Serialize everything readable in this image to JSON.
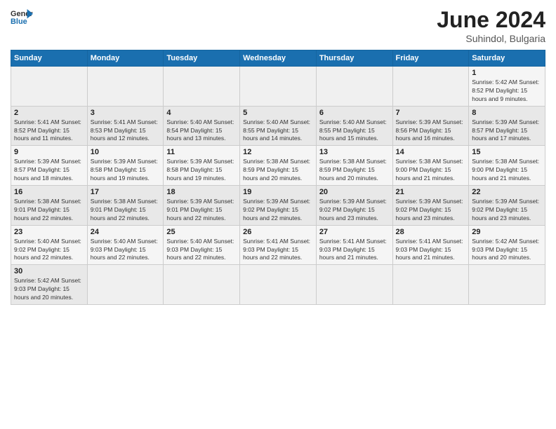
{
  "logo": {
    "general": "General",
    "blue": "Blue"
  },
  "title": {
    "month_year": "June 2024",
    "location": "Suhindol, Bulgaria"
  },
  "weekdays": [
    "Sunday",
    "Monday",
    "Tuesday",
    "Wednesday",
    "Thursday",
    "Friday",
    "Saturday"
  ],
  "weeks": [
    [
      {
        "day": "",
        "info": ""
      },
      {
        "day": "",
        "info": ""
      },
      {
        "day": "",
        "info": ""
      },
      {
        "day": "",
        "info": ""
      },
      {
        "day": "",
        "info": ""
      },
      {
        "day": "",
        "info": ""
      },
      {
        "day": "1",
        "info": "Sunrise: 5:42 AM\nSunset: 8:52 PM\nDaylight: 15 hours and 9 minutes."
      }
    ],
    [
      {
        "day": "2",
        "info": "Sunrise: 5:41 AM\nSunset: 8:52 PM\nDaylight: 15 hours and 11 minutes."
      },
      {
        "day": "3",
        "info": "Sunrise: 5:41 AM\nSunset: 8:53 PM\nDaylight: 15 hours and 12 minutes."
      },
      {
        "day": "4",
        "info": "Sunrise: 5:40 AM\nSunset: 8:54 PM\nDaylight: 15 hours and 13 minutes."
      },
      {
        "day": "5",
        "info": "Sunrise: 5:40 AM\nSunset: 8:55 PM\nDaylight: 15 hours and 14 minutes."
      },
      {
        "day": "6",
        "info": "Sunrise: 5:40 AM\nSunset: 8:55 PM\nDaylight: 15 hours and 15 minutes."
      },
      {
        "day": "7",
        "info": "Sunrise: 5:39 AM\nSunset: 8:56 PM\nDaylight: 15 hours and 16 minutes."
      },
      {
        "day": "8",
        "info": "Sunrise: 5:39 AM\nSunset: 8:57 PM\nDaylight: 15 hours and 17 minutes."
      }
    ],
    [
      {
        "day": "9",
        "info": "Sunrise: 5:39 AM\nSunset: 8:57 PM\nDaylight: 15 hours and 18 minutes."
      },
      {
        "day": "10",
        "info": "Sunrise: 5:39 AM\nSunset: 8:58 PM\nDaylight: 15 hours and 19 minutes."
      },
      {
        "day": "11",
        "info": "Sunrise: 5:39 AM\nSunset: 8:58 PM\nDaylight: 15 hours and 19 minutes."
      },
      {
        "day": "12",
        "info": "Sunrise: 5:38 AM\nSunset: 8:59 PM\nDaylight: 15 hours and 20 minutes."
      },
      {
        "day": "13",
        "info": "Sunrise: 5:38 AM\nSunset: 8:59 PM\nDaylight: 15 hours and 20 minutes."
      },
      {
        "day": "14",
        "info": "Sunrise: 5:38 AM\nSunset: 9:00 PM\nDaylight: 15 hours and 21 minutes."
      },
      {
        "day": "15",
        "info": "Sunrise: 5:38 AM\nSunset: 9:00 PM\nDaylight: 15 hours and 21 minutes."
      }
    ],
    [
      {
        "day": "16",
        "info": "Sunrise: 5:38 AM\nSunset: 9:01 PM\nDaylight: 15 hours and 22 minutes."
      },
      {
        "day": "17",
        "info": "Sunrise: 5:38 AM\nSunset: 9:01 PM\nDaylight: 15 hours and 22 minutes."
      },
      {
        "day": "18",
        "info": "Sunrise: 5:39 AM\nSunset: 9:01 PM\nDaylight: 15 hours and 22 minutes."
      },
      {
        "day": "19",
        "info": "Sunrise: 5:39 AM\nSunset: 9:02 PM\nDaylight: 15 hours and 22 minutes."
      },
      {
        "day": "20",
        "info": "Sunrise: 5:39 AM\nSunset: 9:02 PM\nDaylight: 15 hours and 23 minutes."
      },
      {
        "day": "21",
        "info": "Sunrise: 5:39 AM\nSunset: 9:02 PM\nDaylight: 15 hours and 23 minutes."
      },
      {
        "day": "22",
        "info": "Sunrise: 5:39 AM\nSunset: 9:02 PM\nDaylight: 15 hours and 23 minutes."
      }
    ],
    [
      {
        "day": "23",
        "info": "Sunrise: 5:40 AM\nSunset: 9:02 PM\nDaylight: 15 hours and 22 minutes."
      },
      {
        "day": "24",
        "info": "Sunrise: 5:40 AM\nSunset: 9:03 PM\nDaylight: 15 hours and 22 minutes."
      },
      {
        "day": "25",
        "info": "Sunrise: 5:40 AM\nSunset: 9:03 PM\nDaylight: 15 hours and 22 minutes."
      },
      {
        "day": "26",
        "info": "Sunrise: 5:41 AM\nSunset: 9:03 PM\nDaylight: 15 hours and 22 minutes."
      },
      {
        "day": "27",
        "info": "Sunrise: 5:41 AM\nSunset: 9:03 PM\nDaylight: 15 hours and 21 minutes."
      },
      {
        "day": "28",
        "info": "Sunrise: 5:41 AM\nSunset: 9:03 PM\nDaylight: 15 hours and 21 minutes."
      },
      {
        "day": "29",
        "info": "Sunrise: 5:42 AM\nSunset: 9:03 PM\nDaylight: 15 hours and 20 minutes."
      }
    ],
    [
      {
        "day": "30",
        "info": "Sunrise: 5:42 AM\nSunset: 9:03 PM\nDaylight: 15 hours and 20 minutes."
      },
      {
        "day": "",
        "info": ""
      },
      {
        "day": "",
        "info": ""
      },
      {
        "day": "",
        "info": ""
      },
      {
        "day": "",
        "info": ""
      },
      {
        "day": "",
        "info": ""
      },
      {
        "day": "",
        "info": ""
      }
    ]
  ]
}
